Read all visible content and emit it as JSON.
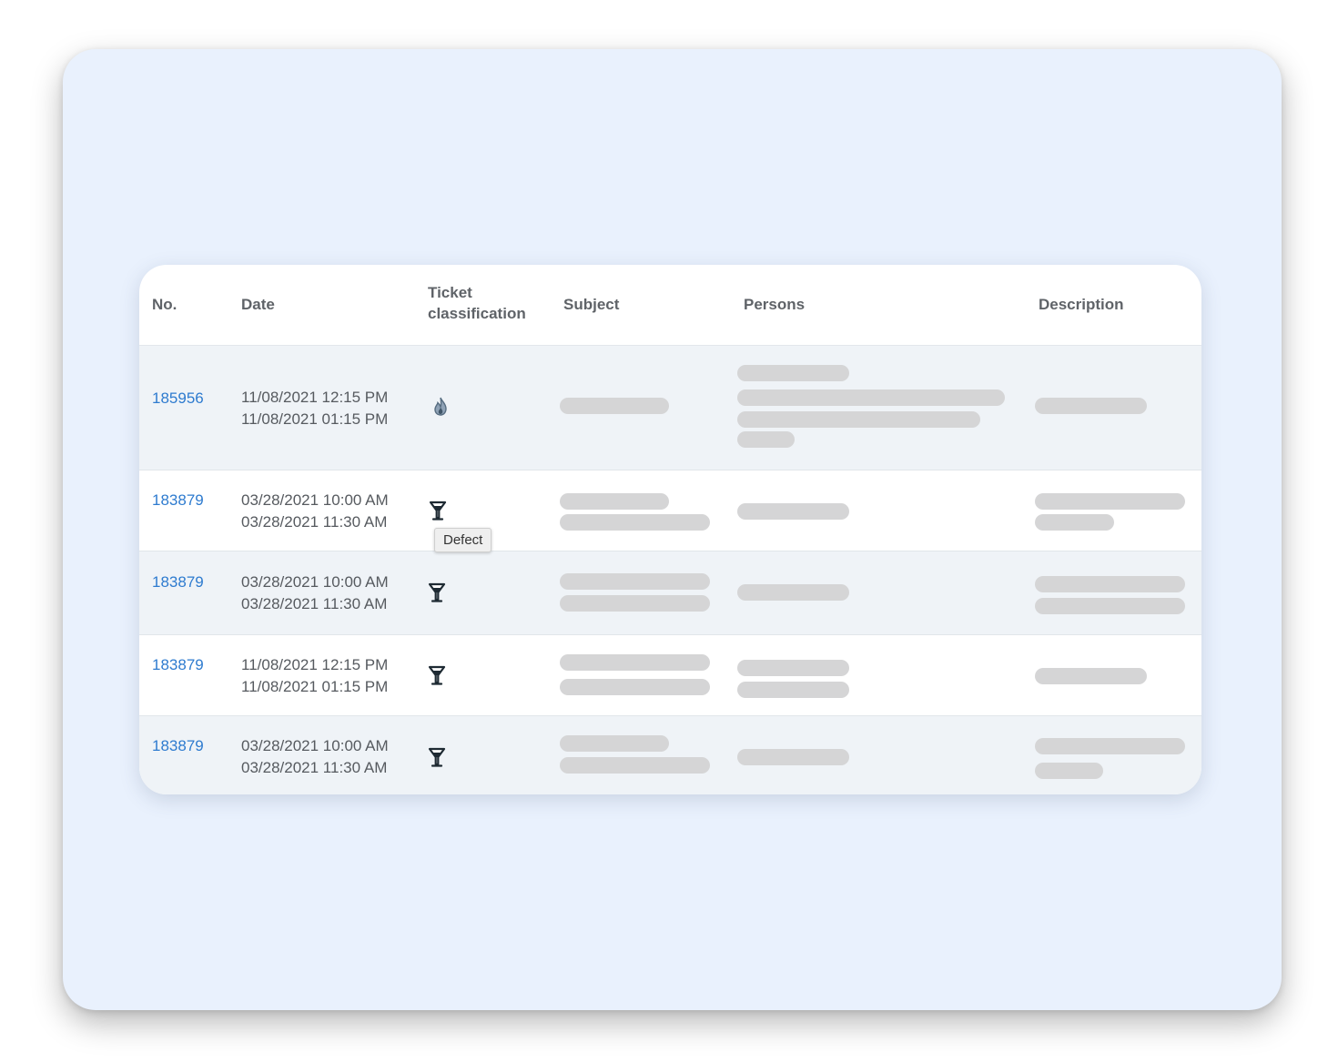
{
  "table": {
    "headers": {
      "no": "No.",
      "date": "Date",
      "classification_line1": "Ticket",
      "classification_line2": "classification",
      "subject": "Subject",
      "persons": "Persons",
      "description": "Description"
    },
    "rows": [
      {
        "no": "185956",
        "date_start": "11/08/2021 12:15 PM",
        "date_end": "11/08/2021 01:15 PM",
        "icon": "flame-icon"
      },
      {
        "no": "183879",
        "date_start": "03/28/2021 10:00 AM",
        "date_end": "03/28/2021 11:30 AM",
        "icon": "funnel-icon"
      },
      {
        "no": "183879",
        "date_start": "03/28/2021 10:00 AM",
        "date_end": "03/28/2021 11:30 AM",
        "icon": "funnel-icon"
      },
      {
        "no": "183879",
        "date_start": "11/08/2021 12:15 PM",
        "date_end": "11/08/2021 01:15 PM",
        "icon": "funnel-icon"
      },
      {
        "no": "183879",
        "date_start": "03/28/2021 10:00 AM",
        "date_end": "03/28/2021 11:30 AM",
        "icon": "funnel-icon"
      }
    ]
  },
  "tooltip": {
    "text": "Defect"
  },
  "colors": {
    "link": "#2e7bcf",
    "row_alt": "#eff3f7",
    "placeholder": "#d5d5d6",
    "backdrop": "#e9f1fd"
  }
}
